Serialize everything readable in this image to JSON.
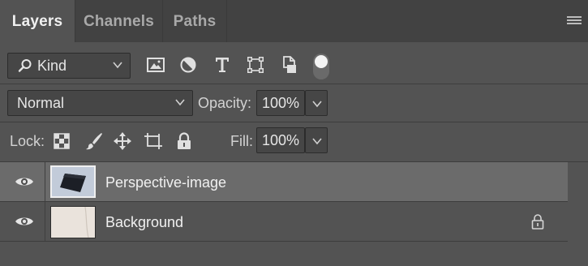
{
  "tabs": [
    {
      "label": "Layers",
      "active": true
    },
    {
      "label": "Channels",
      "active": false
    },
    {
      "label": "Paths",
      "active": false
    }
  ],
  "filter": {
    "kind_label": "Kind",
    "icons": [
      "pixel-filter-icon",
      "adjustment-filter-icon",
      "type-filter-icon",
      "shape-filter-icon",
      "smart-object-filter-icon"
    ],
    "toggle_on": true
  },
  "blend": {
    "mode": "Normal",
    "opacity_label": "Opacity:",
    "opacity_value": "100%"
  },
  "lock": {
    "label": "Lock:",
    "icons": [
      "lock-transparent-pixels-icon",
      "lock-image-pixels-icon",
      "lock-position-icon",
      "lock-artboard-icon",
      "lock-all-icon"
    ],
    "fill_label": "Fill:",
    "fill_value": "100%"
  },
  "layers": [
    {
      "name": "Perspective-image",
      "visible": true,
      "selected": true,
      "locked": false
    },
    {
      "name": "Background",
      "visible": true,
      "selected": false,
      "locked": true
    }
  ],
  "colors": {
    "panel_bg": "#535353",
    "tabbar_bg": "#424242",
    "selected_row": "#6b6b6b",
    "field_bg": "#464646"
  }
}
